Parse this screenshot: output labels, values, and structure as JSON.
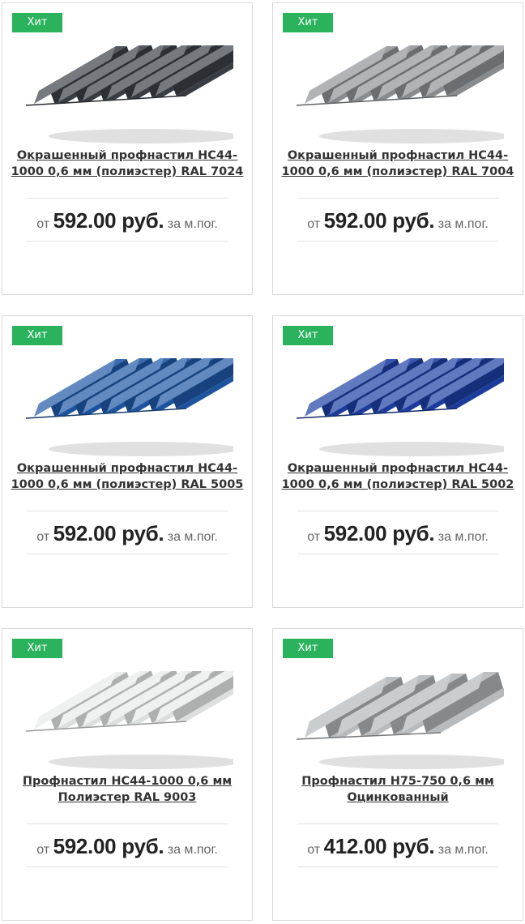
{
  "products": [
    {
      "badge": "Хит",
      "title": "Окрашенный профнастил НС44-1000 0,6 мм (полиэстер) RAL 7024",
      "price_prefix": "от",
      "price": "592.00 руб.",
      "price_suffix": "за м.пог.",
      "color": "#3b4046",
      "image": "sheet-profiled-ral7024"
    },
    {
      "badge": "Хит",
      "title": "Окрашенный профнастил НС44-1000 0,6 мм (полиэстер) RAL 7004",
      "price_prefix": "от",
      "price": "592.00 руб.",
      "price_suffix": "за м.пог.",
      "color": "#8f9396",
      "image": "sheet-profiled-ral7004"
    },
    {
      "badge": "Хит",
      "title": "Окрашенный профнастил НС44-1000 0,6 мм (полиэстер) RAL 5005",
      "price_prefix": "от",
      "price": "592.00 руб.",
      "price_suffix": "за м.пог.",
      "color": "#1f58a6",
      "image": "sheet-profiled-ral5005"
    },
    {
      "badge": "Хит",
      "title": "Окрашенный профнастил НС44-1000 0,6 мм (полиэстер) RAL 5002",
      "price_prefix": "от",
      "price": "592.00 руб.",
      "price_suffix": "за м.пог.",
      "color": "#1d3fa3",
      "image": "sheet-profiled-ral5002"
    },
    {
      "badge": "Хит",
      "title": "Профнастил НС44-1000 0,6 мм Полиэстер RAL 9003",
      "price_prefix": "от",
      "price": "592.00 руб.",
      "price_suffix": "за м.пог.",
      "color": "#e8ebe9",
      "image": "sheet-profiled-ral9003"
    },
    {
      "badge": "Хит",
      "title": "Профнастил Н75-750 0,6 мм Оцинкованный",
      "price_prefix": "от",
      "price": "412.00 руб.",
      "price_suffix": "за м.пог.",
      "color": "#b3b7ba",
      "image": "sheet-profiled-galvanized"
    }
  ],
  "accent_color": "#2ab35c"
}
